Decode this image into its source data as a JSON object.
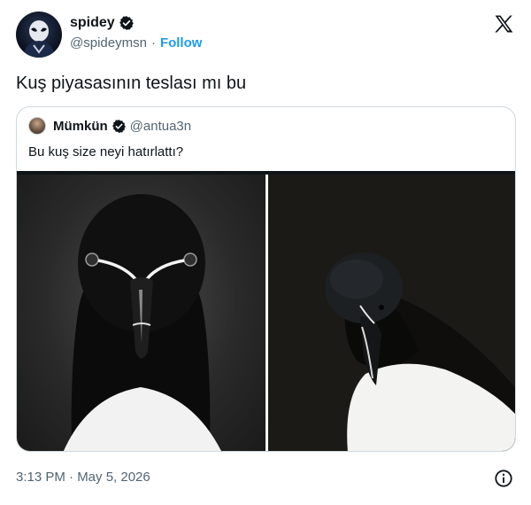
{
  "author": {
    "display_name": "spidey",
    "handle": "@spideymsn",
    "separator": "·",
    "follow_label": "Follow",
    "verified": true
  },
  "platform_icon": "x-logo-icon",
  "tweet": {
    "text": "Kuş piyasasının teslası mı bu"
  },
  "quoted": {
    "display_name": "Mümkün",
    "handle": "@antua3n",
    "verified": true,
    "text": "Bu kuş size neyi hatırlattı?",
    "media": [
      {
        "description_icon": "razorbill-front-photo"
      },
      {
        "description_icon": "razorbill-side-photo"
      }
    ]
  },
  "footer": {
    "timestamp": "3:13 PM · May 5, 2026",
    "info_icon": "info-icon"
  },
  "colors": {
    "link_blue": "#1d9bf0",
    "verified_badge": "#0f1419",
    "secondary_text": "#536471",
    "border": "#cfd9de"
  }
}
